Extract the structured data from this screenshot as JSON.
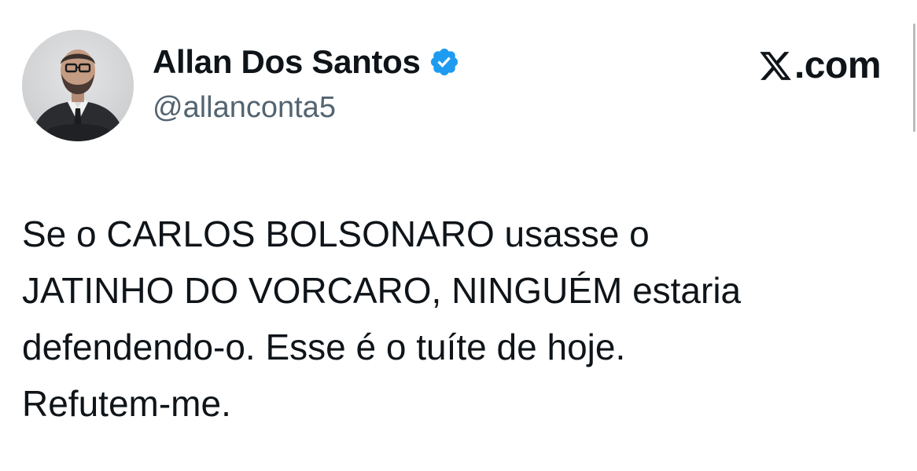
{
  "tweet": {
    "author": {
      "display_name": "Allan Dos Santos",
      "handle": "@allanconta5",
      "verified": true,
      "verified_color": "#1d9bf0",
      "avatar_icon": "profile-photo"
    },
    "brand": {
      "logo_icon": "x-logo-icon",
      "suffix": ".com"
    },
    "text_lines": [
      "Se o CARLOS BOLSONARO usasse o",
      "JATINHO DO VORCARO, NINGUÉM estaria",
      "defendendo-o. Esse é o tuíte de hoje.",
      "Refutem-me."
    ]
  },
  "colors": {
    "background": "#ffffff",
    "text_primary": "#0f1419",
    "text_secondary": "#536471",
    "verified_blue": "#1d9bf0"
  }
}
